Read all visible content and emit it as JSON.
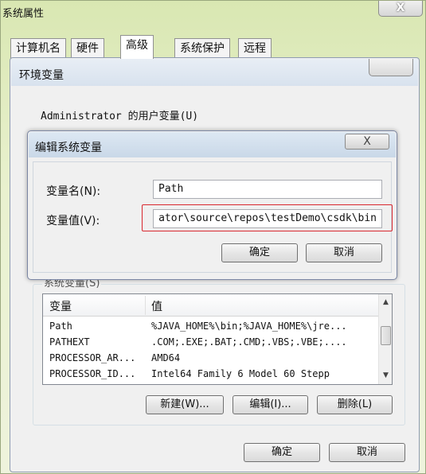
{
  "system_properties": {
    "title": "系统属性",
    "close_glyph": "X",
    "tabs": [
      {
        "label": "计算机名",
        "active": false
      },
      {
        "label": "硬件",
        "active": false
      },
      {
        "label": "高级",
        "active": true
      },
      {
        "label": "系统保护",
        "active": false
      },
      {
        "label": "远程",
        "active": false
      }
    ]
  },
  "env_window": {
    "title": "环境变量",
    "user_vars_label": "Administrator 的用户变量(U)",
    "system_vars_label": "系统变量(S)",
    "columns": [
      "变量",
      "值"
    ],
    "rows": [
      {
        "name": "Path",
        "value": "%JAVA_HOME%\\bin;%JAVA_HOME%\\jre..."
      },
      {
        "name": "PATHEXT",
        "value": ".COM;.EXE;.BAT;.CMD;.VBS;.VBE;...."
      },
      {
        "name": "PROCESSOR_AR...",
        "value": "AMD64"
      },
      {
        "name": "PROCESSOR_ID...",
        "value": "Intel64 Family 6 Model 60 Stepp"
      }
    ],
    "buttons": {
      "new": "新建(W)...",
      "edit": "编辑(I)...",
      "delete": "删除(L)",
      "ok": "确定",
      "cancel": "取消"
    }
  },
  "edit_dialog": {
    "title": "编辑系统变量",
    "close_glyph": "X",
    "name_label": "变量名(N):",
    "value_label": "变量值(V):",
    "name_value": "Path",
    "value_value": "ator\\source\\repos\\testDemo\\csdk\\bin",
    "ok": "确定",
    "cancel": "取消"
  },
  "colors": {
    "highlight": "#d9272e",
    "titlebar": "#d8e2ee",
    "window_bg": "#f0f0f0"
  }
}
